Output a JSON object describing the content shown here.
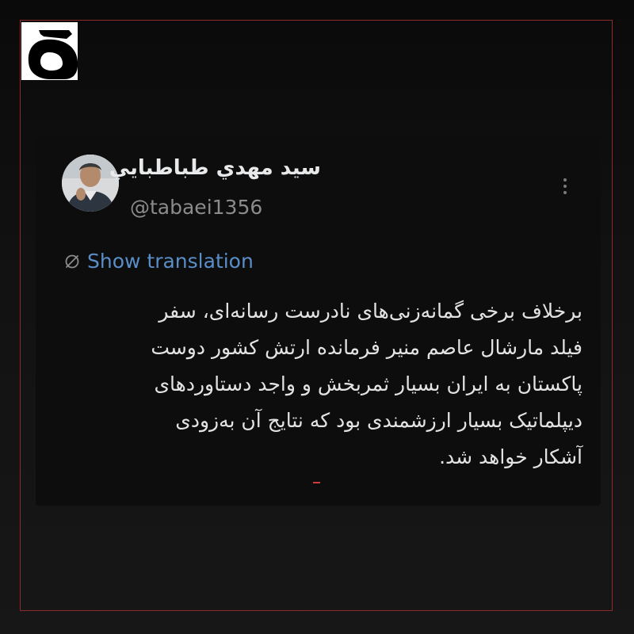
{
  "logo": {
    "icon": "black-glyph-logo-icon",
    "colors": {
      "background": "#ffffff",
      "glyph": "#000000"
    }
  },
  "frame": {
    "border_color": "#8e2a2a"
  },
  "tweet": {
    "author": {
      "display_name": "سید مهدي طباطبايي",
      "handle": "@tabaei1356",
      "avatar_icon": "avatar-photo"
    },
    "more_icon": "more-vertical-icon",
    "translation": {
      "icon": "globe-slash-icon",
      "label": "Show translation",
      "color": "#5a8ec8"
    },
    "body_lines": [
      "برخلاف برخی گمانه‌زنی‌های نادرست رسانه‌ای، سفر",
      "فیلد مارشال عاصم منیر فرمانده ارتش کشور دوست",
      "پاکستان به ایران بسیار ثمربخش و واجد دستاوردهای",
      "دیپلماتیک بسیار ارزشمندی بود که نتایج آن به‌زودی",
      "آشکار خواهد شد."
    ]
  },
  "colors": {
    "page_background": "#0e0e0e",
    "text_primary": "#e7e9ea",
    "text_secondary": "#8b8b8b",
    "accent_red": "#d23a3a"
  }
}
